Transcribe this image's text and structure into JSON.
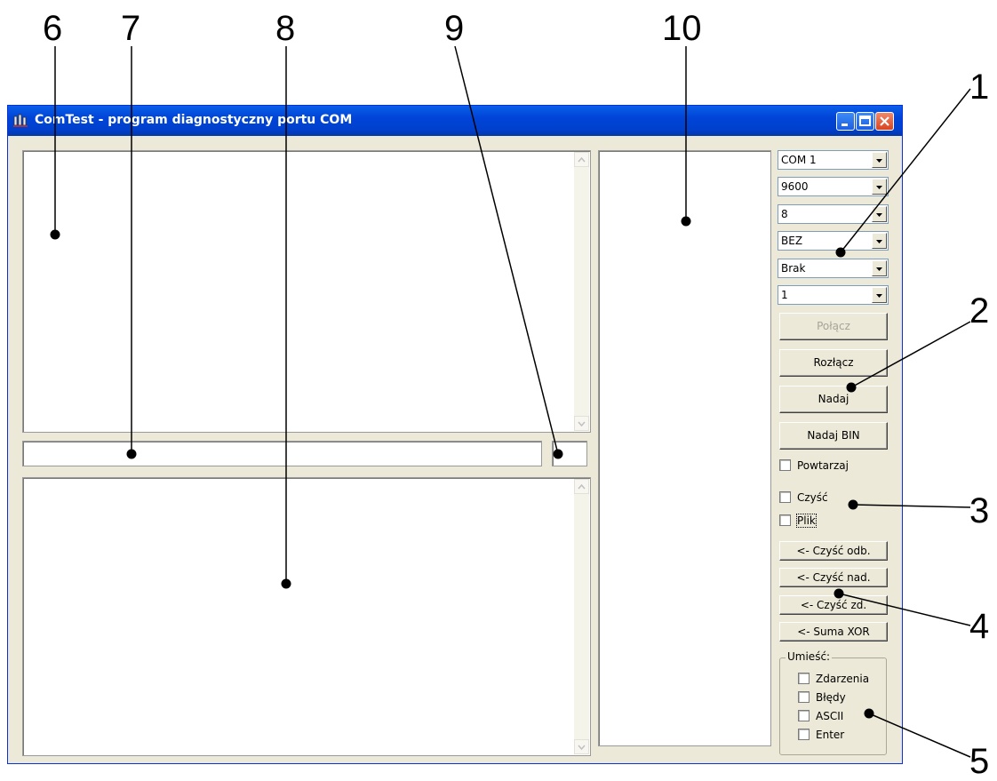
{
  "window": {
    "title": "ComTest - program diagnostyczny portu COM"
  },
  "callouts": [
    "6",
    "7",
    "8",
    "9",
    "10",
    "1",
    "2",
    "3",
    "4",
    "5"
  ],
  "settings": {
    "port": "COM 1",
    "baud": "9600",
    "data_bits": "8",
    "parity": "BEZ",
    "flow": "Brak",
    "stop_bits": "1"
  },
  "buttons": {
    "connect": "Połącz",
    "disconnect": "Rozłącz",
    "send": "Nadaj",
    "send_bin": "Nadaj BIN"
  },
  "checkboxes": {
    "repeat": "Powtarzaj",
    "clear": "Czyść",
    "file": "Plik"
  },
  "small_buttons": {
    "clear_recv": "<- Czyść odb.",
    "clear_send": "<- Czyść nad.",
    "clear_events": "<- Czyść zd.",
    "xor_sum": "<- Suma XOR"
  },
  "place_group": {
    "label": "Umieść:",
    "items": [
      "Zdarzenia",
      "Błędy",
      "ASCII",
      "Enter"
    ]
  }
}
